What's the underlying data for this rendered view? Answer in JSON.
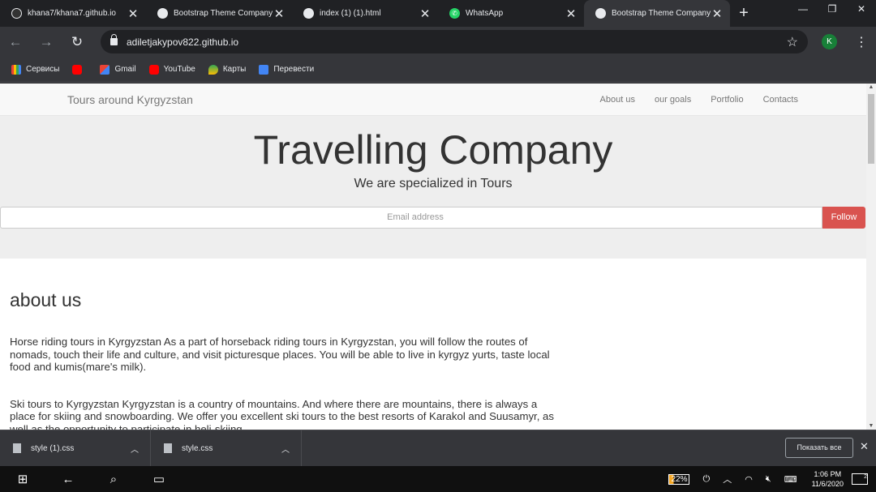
{
  "tabs": [
    {
      "title": "khana7/khana7.github.io",
      "icon": "github-icon",
      "active": false
    },
    {
      "title": "Bootstrap Theme Company",
      "icon": "globe-icon",
      "active": false
    },
    {
      "title": "index (1) (1).html",
      "icon": "globe-icon",
      "active": false
    },
    {
      "title": "WhatsApp",
      "icon": "whatsapp-icon",
      "active": false
    },
    {
      "title": "Bootstrap Theme Company",
      "icon": "globe-icon",
      "active": true
    }
  ],
  "address": {
    "url": "adiletjakypov822.github.io"
  },
  "profile": {
    "initial": "K",
    "color": "#188038"
  },
  "bookmarks": [
    {
      "label": "Сервисы",
      "icon": "apps-grid-icon"
    },
    {
      "label": "",
      "icon": "youtube-icon"
    },
    {
      "label": "Gmail",
      "icon": "gmail-icon"
    },
    {
      "label": "YouTube",
      "icon": "youtube-icon"
    },
    {
      "label": "Карты",
      "icon": "maps-icon"
    },
    {
      "label": "Перевести",
      "icon": "translate-icon"
    }
  ],
  "site": {
    "brand": "Tours around Kyrgyzstan",
    "nav": [
      "About us",
      "our goals",
      "Portfolio",
      "Contacts"
    ],
    "hero_title": "Travelling Company",
    "hero_subtitle": "We are specialized in Tours",
    "email_placeholder": "Email address",
    "follow_label": "Follow",
    "follow_color": "#d9534f",
    "about_heading": "about us",
    "about_p1": "Horse riding tours in Kyrgyzstan As a part of horseback riding tours in Kyrgyzstan, you will follow the routes of nomads, touch their life and culture, and visit picturesque places. You will be able to live in kyrgyz yurts, taste local food and kumis(mare's milk).",
    "about_p2": "Ski tours to Kyrgyzstan Kyrgyzstan is a country of mountains. And where there are mountains, there is always a place for skiing and snowboarding. We offer you excellent ski tours to the best resorts of Karakol and Suusamyr, as well as the opportunity to participate in heli-skiing."
  },
  "downloads": [
    {
      "file": "style (1).css"
    },
    {
      "file": "style.css"
    }
  ],
  "downloads_show_all": "Показать все",
  "taskbar": {
    "battery": "22%",
    "time": "1:06 PM",
    "date": "11/6/2020",
    "notifications": "2"
  }
}
